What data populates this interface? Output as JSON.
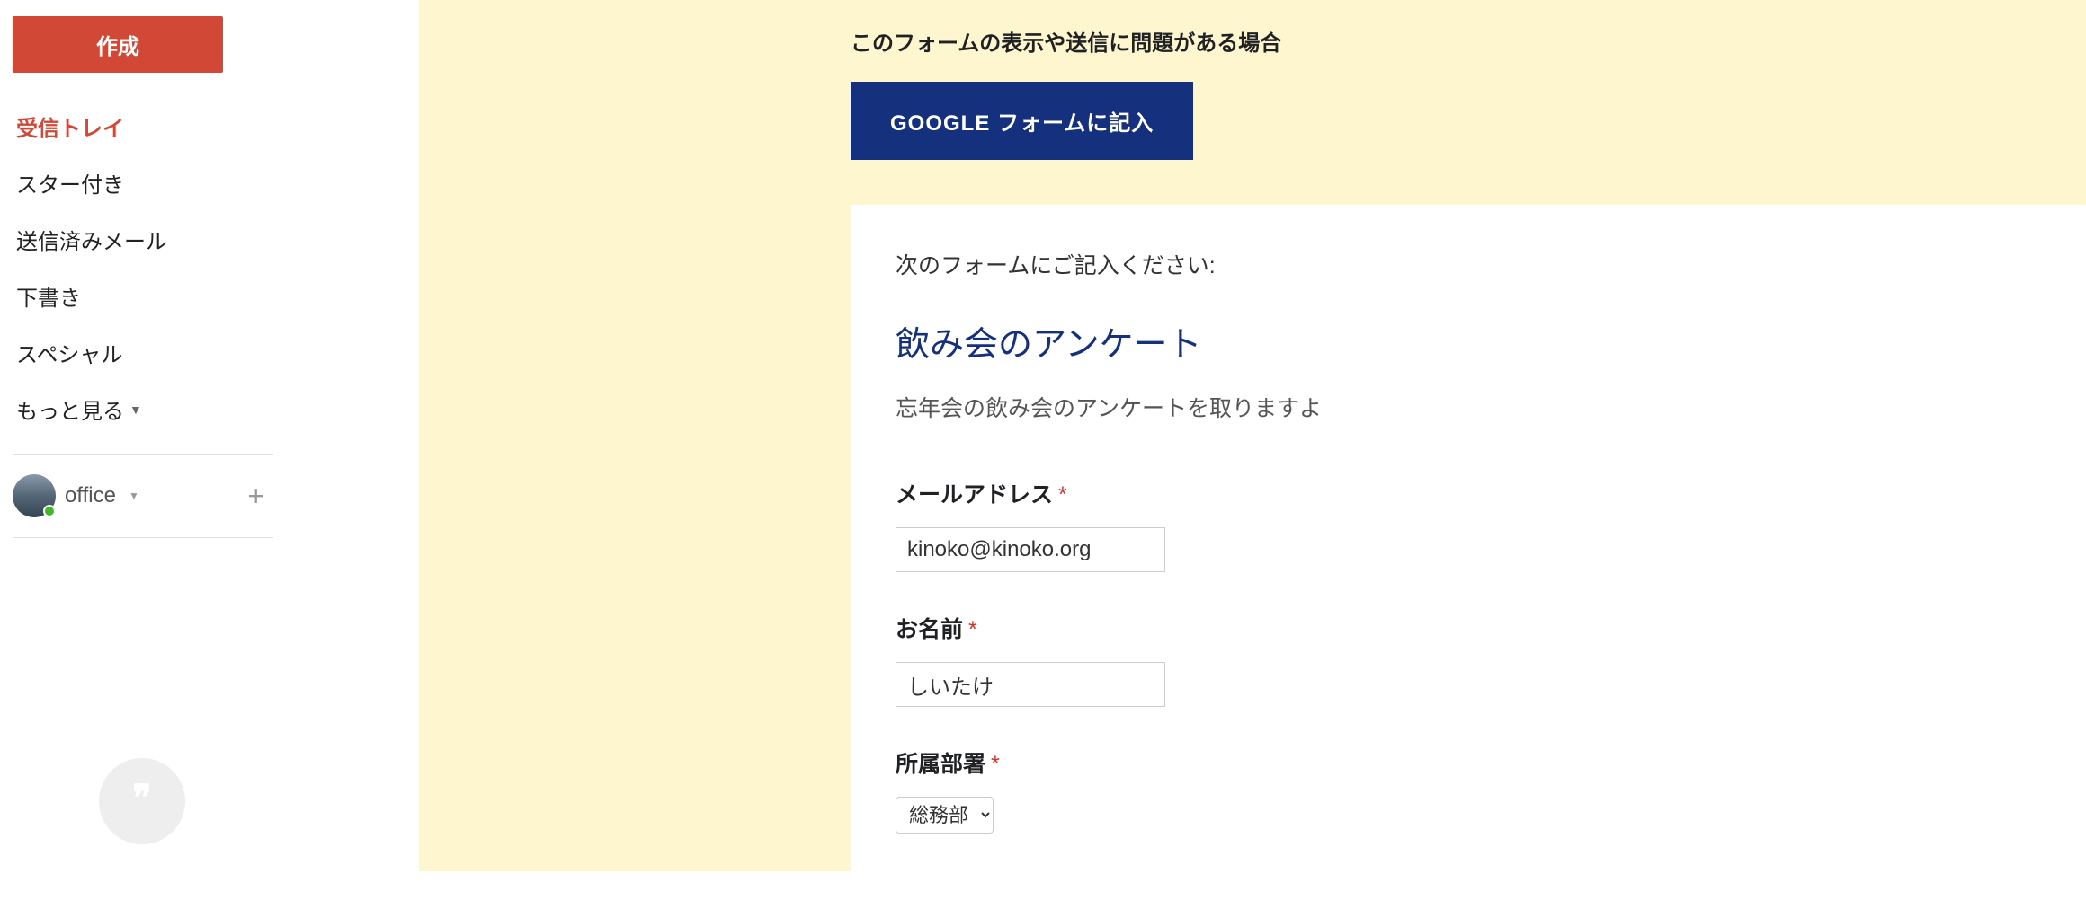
{
  "sidebar": {
    "compose_label": "作成",
    "nav_items": [
      {
        "label": "受信トレイ",
        "active": true
      },
      {
        "label": "スター付き",
        "active": false
      },
      {
        "label": "送信済みメール",
        "active": false
      },
      {
        "label": "下書き",
        "active": false
      },
      {
        "label": "スペシャル",
        "active": false
      }
    ],
    "more_label": "もっと見る",
    "chat_user_name": "office"
  },
  "email": {
    "notice_text": "このフォームの表示や送信に問題がある場合",
    "form_button_label": "GOOGLE フォームに記入",
    "form_instruction": "次のフォームにご記入ください:",
    "form_title": "飲み会のアンケート",
    "form_description": "忘年会の飲み会のアンケートを取りますよ",
    "fields": {
      "email": {
        "label": "メールアドレス",
        "value": "kinoko@kinoko.org"
      },
      "name": {
        "label": "お名前",
        "value": "しいたけ"
      },
      "department": {
        "label": "所属部署",
        "value": "総務部"
      }
    }
  }
}
